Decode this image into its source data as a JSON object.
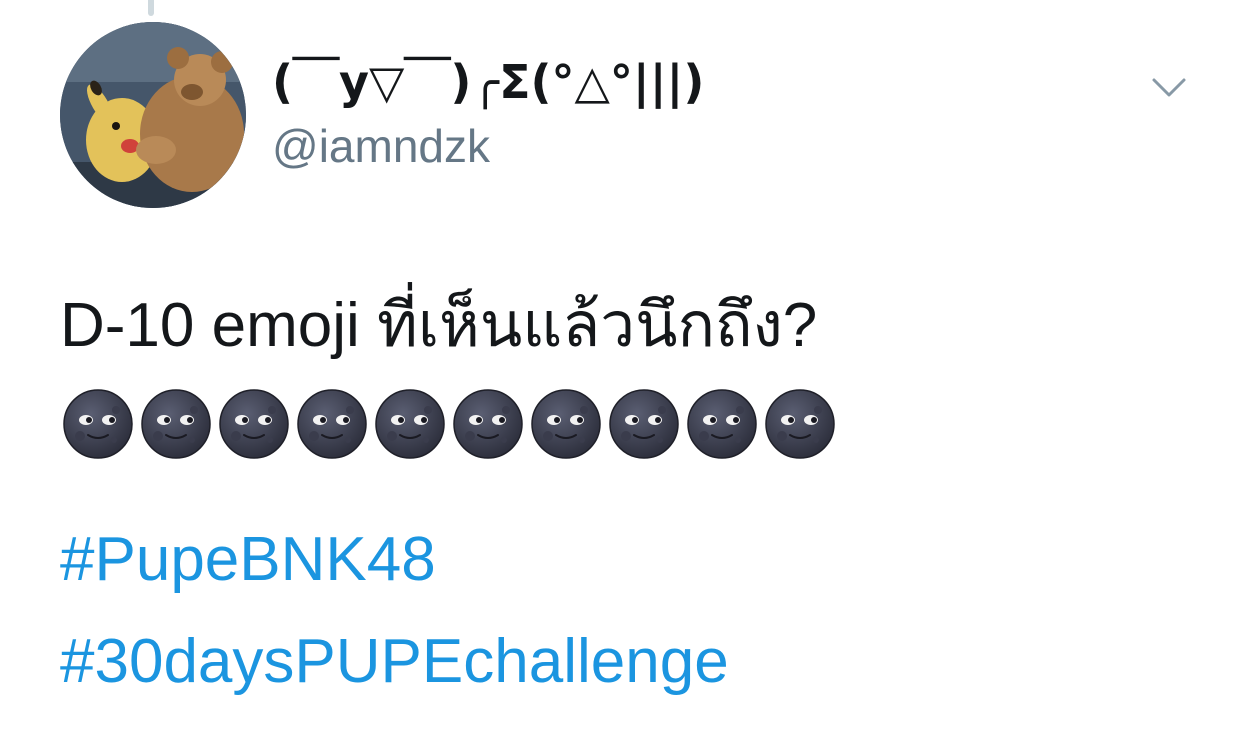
{
  "tweet": {
    "display_name": "(￣y▽￣)╭Σ(°△°|||)",
    "handle": "@iamndzk",
    "text": "D-10 emoji ที่เห็นแล้วนึกถึง?",
    "emoji_name": "new-moon-face",
    "emoji_count": 10,
    "hashtags": [
      "#PupeBNK48",
      "#30daysPUPEchallenge"
    ]
  },
  "colors": {
    "text_primary": "#14171a",
    "text_secondary": "#657786",
    "link": "#1b95e0",
    "background": "#ffffff",
    "chevron": "#8899a6"
  },
  "icons": {
    "menu": "chevron-down-icon",
    "avatar": "avatar-image"
  }
}
